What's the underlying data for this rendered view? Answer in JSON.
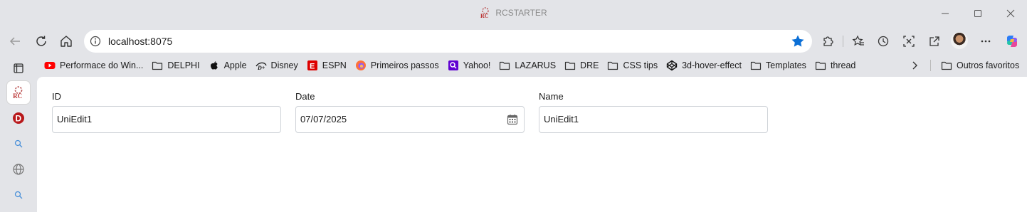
{
  "window": {
    "title": "RCSTARTER"
  },
  "toolbar": {
    "url_host": "localhost",
    "url_port": ":8075"
  },
  "bookmarks": [
    {
      "label": "Performace do Win...",
      "icon": "youtube-icon"
    },
    {
      "label": "DELPHI",
      "icon": "folder-icon"
    },
    {
      "label": "Apple",
      "icon": "apple-icon"
    },
    {
      "label": "Disney",
      "icon": "disney-icon"
    },
    {
      "label": "ESPN",
      "icon": "espn-icon"
    },
    {
      "label": "Primeiros passos",
      "icon": "firefox-icon"
    },
    {
      "label": "Yahoo!",
      "icon": "yahoo-icon"
    },
    {
      "label": "LAZARUS",
      "icon": "folder-icon"
    },
    {
      "label": "DRE",
      "icon": "folder-icon"
    },
    {
      "label": "CSS tips",
      "icon": "folder-icon"
    },
    {
      "label": "3d-hover-effect",
      "icon": "codepen-icon"
    },
    {
      "label": "Templates",
      "icon": "folder-icon"
    },
    {
      "label": "thread",
      "icon": "folder-icon"
    }
  ],
  "other_favorites": "Outros favoritos",
  "form": {
    "id_label": "ID",
    "id_value": "UniEdit1",
    "date_label": "Date",
    "date_value": "07/07/2025",
    "name_label": "Name",
    "name_value": "UniEdit1"
  },
  "colors": {
    "accent": "#0b6fd6",
    "chrome_bg": "#e3e4e8",
    "content_bg": "#ffffff"
  }
}
